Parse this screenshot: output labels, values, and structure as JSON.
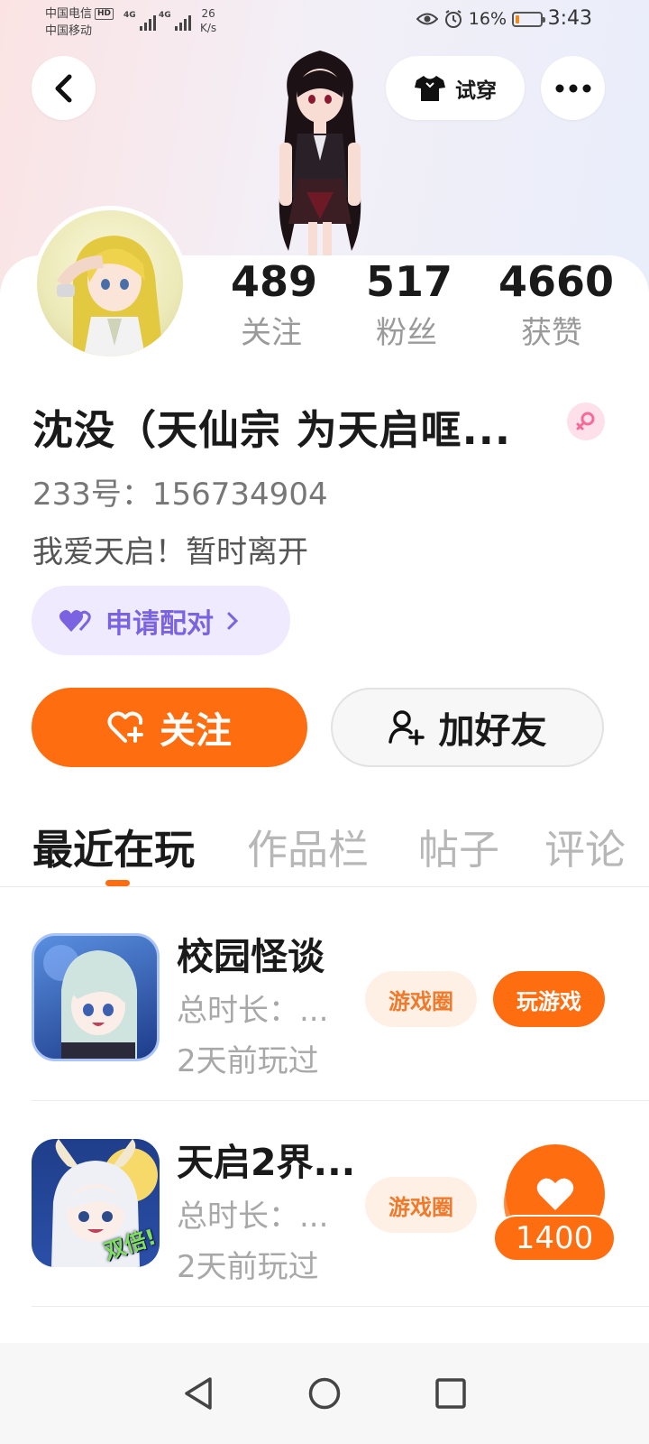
{
  "status_bar": {
    "carrier1": "中国电信",
    "carrier2": "中国移动",
    "hd": "HD",
    "net1": "4G",
    "net2": "4G",
    "speed_value": "26",
    "speed_unit": "K/s",
    "battery": "16%",
    "time": "3:43",
    "battery_level": 0.16
  },
  "header": {
    "try_on_label": "试穿"
  },
  "profile": {
    "following_count": "489",
    "following_label": "关注",
    "fans_count": "517",
    "fans_label": "粉丝",
    "likes_count": "4660",
    "likes_label": "获赞",
    "username": "沈没（天仙宗 为天启哐...",
    "uid": "233号：156734904",
    "bio": "我爱天启！暂时离开",
    "pair_label": "申请配对",
    "follow_label": "关注",
    "add_friend_label": "加好友"
  },
  "tabs": [
    {
      "label": "最近在玩",
      "active": true
    },
    {
      "label": "作品栏",
      "active": false
    },
    {
      "label": "帖子",
      "active": false
    },
    {
      "label": "评论",
      "active": false
    }
  ],
  "games": [
    {
      "title": "校园怪谈",
      "total_time": "总时长：...",
      "last_played": "2天前玩过",
      "circle_label": "游戏圈",
      "play_label": "玩游戏"
    },
    {
      "title": "天启2界...",
      "total_time": "总时长：...",
      "last_played": "2天前玩过",
      "circle_label": "游戏圈",
      "badge": "双倍!"
    }
  ],
  "floating_like": {
    "count": "1400"
  },
  "colors": {
    "accent": "#ff6d11",
    "pair_purple": "#7a62e0",
    "muted": "#9a9a9a"
  }
}
